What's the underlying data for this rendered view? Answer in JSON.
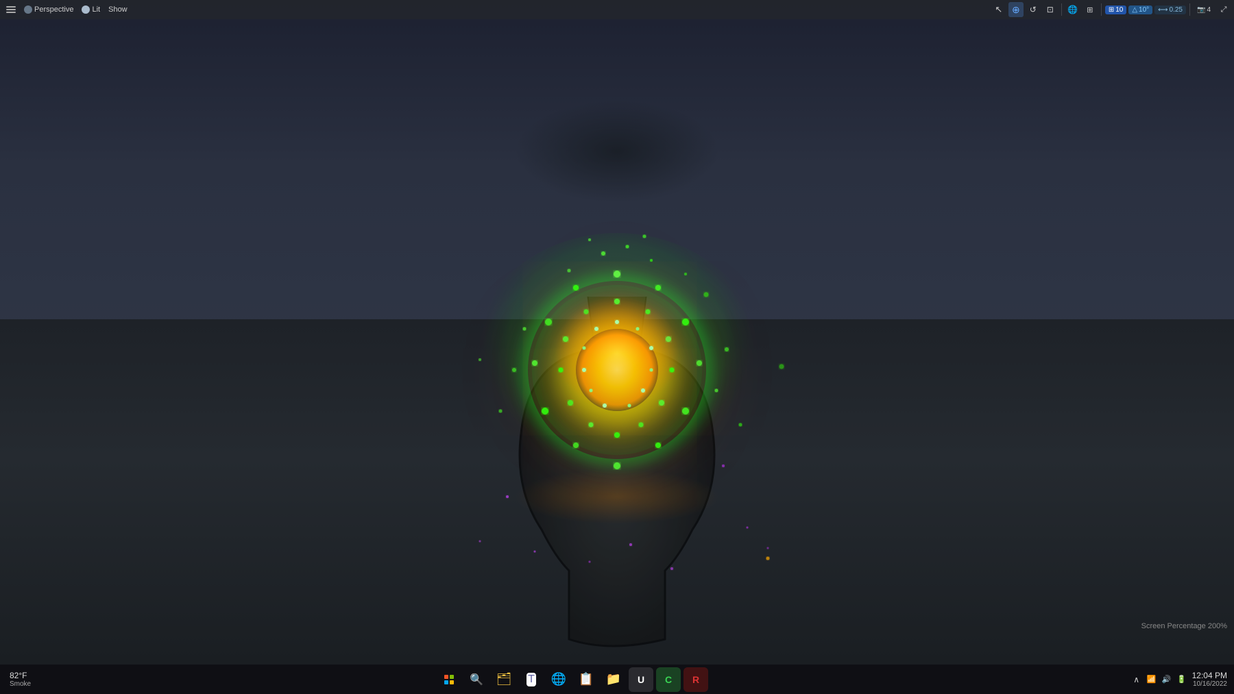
{
  "viewport": {
    "mode": "Perspective",
    "lighting": "Lit",
    "show": "Show"
  },
  "toolbar": {
    "left": {
      "menu_icon": "☰",
      "perspective_label": "Perspective",
      "lit_label": "Lit",
      "show_label": "Show"
    },
    "right": {
      "cursor_icon": "↖",
      "translate_icon": "+",
      "rotate_icon": "↻",
      "scale_icon": "⊡",
      "camera_icon": "⊞",
      "grid_icon": "⊞",
      "grid_value": "10",
      "snap_icon": "△",
      "snap_value": "10°",
      "scale_val_icon": "⟷",
      "scale_val": "0.25",
      "camera_val_icon": "⊡",
      "camera_val": "4",
      "maximize_icon": "⊡"
    }
  },
  "screen_percentage": {
    "label": "Screen Percentage",
    "value": "200%"
  },
  "taskbar": {
    "weather": {
      "temp": "82°F",
      "description": "Smoke"
    },
    "apps": [
      {
        "name": "windows-start",
        "icon": "win",
        "color": "#00adef"
      },
      {
        "name": "search",
        "icon": "🔍",
        "color": "#ffffff"
      },
      {
        "name": "file-explorer",
        "icon": "📁",
        "color": "#f0c040"
      },
      {
        "name": "teams",
        "icon": "👥",
        "color": "#6264a7"
      },
      {
        "name": "chrome",
        "icon": "🌐",
        "color": "#4285f4"
      },
      {
        "name": "sticky-notes",
        "icon": "📝",
        "color": "#f9d71c"
      },
      {
        "name": "files",
        "icon": "📂",
        "color": "#e8a000"
      },
      {
        "name": "unreal-engine",
        "icon": "U",
        "color": "#ffffff"
      },
      {
        "name": "crashpad",
        "icon": "C",
        "color": "#39d353"
      },
      {
        "name": "app-red",
        "icon": "R",
        "color": "#dd3333"
      }
    ],
    "system_tray": {
      "chevron": "^",
      "wifi": "📶",
      "sound": "🔊",
      "battery": "🔋"
    },
    "clock": {
      "time": "12:04 PM",
      "date": "10/16/2022"
    }
  }
}
